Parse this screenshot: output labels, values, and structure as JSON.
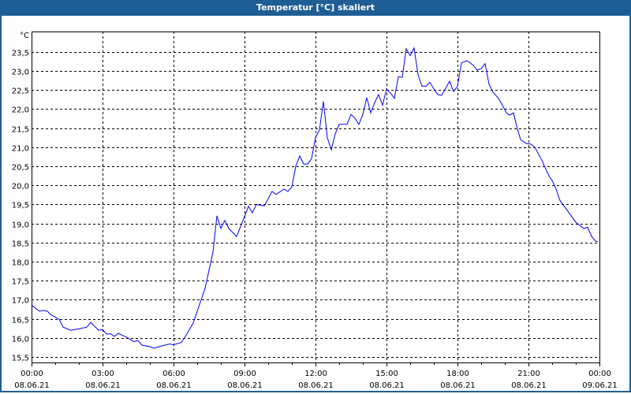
{
  "window": {
    "title": "Temperatur [°C] skaliert"
  },
  "chart_data": {
    "type": "line",
    "title": "Temperatur [°C] skaliert",
    "ylabel": "°C",
    "xlabel": "",
    "xlim_hours": [
      0,
      24
    ],
    "ylim": [
      15.35,
      23.8
    ],
    "grid": true,
    "line_color": "#0000ff",
    "yticks": [
      "15,5",
      "16,0",
      "16,5",
      "17,0",
      "17,5",
      "18,0",
      "18,5",
      "19,0",
      "19,5",
      "20,0",
      "20,5",
      "21,0",
      "21,5",
      "22,0",
      "22,5",
      "23,0",
      "23,5"
    ],
    "ytick_values": [
      15.5,
      16,
      16.5,
      17,
      17.5,
      18,
      18.5,
      19,
      19.5,
      20,
      20.5,
      21,
      21.5,
      22,
      22.5,
      23,
      23.5
    ],
    "xticks": [
      {
        "hour": 0,
        "time": "00:00",
        "date": "08.06.21"
      },
      {
        "hour": 3,
        "time": "03:00",
        "date": "08.06.21"
      },
      {
        "hour": 6,
        "time": "06:00",
        "date": "08.06.21"
      },
      {
        "hour": 9,
        "time": "09:00",
        "date": "08.06.21"
      },
      {
        "hour": 12,
        "time": "12:00",
        "date": "08.06.21"
      },
      {
        "hour": 15,
        "time": "15:00",
        "date": "08.06.21"
      },
      {
        "hour": 18,
        "time": "18:00",
        "date": "08.06.21"
      },
      {
        "hour": 21,
        "time": "21:00",
        "date": "08.06.21"
      },
      {
        "hour": 24,
        "time": "00:00",
        "date": "09.06.21"
      }
    ],
    "series": [
      {
        "name": "Temperatur",
        "points": [
          [
            0,
            16.86
          ],
          [
            0.333,
            16.7
          ],
          [
            0.5,
            16.72
          ],
          [
            0.667,
            16.7
          ],
          [
            0.833,
            16.6
          ],
          [
            1.167,
            16.49
          ],
          [
            1.333,
            16.28
          ],
          [
            1.667,
            16.2
          ],
          [
            2,
            16.24
          ],
          [
            2.333,
            16.28
          ],
          [
            2.5,
            16.41
          ],
          [
            2.833,
            16.2
          ],
          [
            3,
            16.22
          ],
          [
            3.167,
            16.1
          ],
          [
            3.333,
            16.11
          ],
          [
            3.5,
            16.04
          ],
          [
            3.667,
            16.12
          ],
          [
            4,
            16.02
          ],
          [
            4.333,
            15.9
          ],
          [
            4.5,
            15.93
          ],
          [
            4.667,
            15.81
          ],
          [
            5,
            15.77
          ],
          [
            5.167,
            15.73
          ],
          [
            5.5,
            15.79
          ],
          [
            5.833,
            15.84
          ],
          [
            6,
            15.82
          ],
          [
            6.333,
            15.88
          ],
          [
            6.5,
            16.04
          ],
          [
            6.833,
            16.39
          ],
          [
            7.167,
            17.0
          ],
          [
            7.333,
            17.3
          ],
          [
            7.667,
            18.25
          ],
          [
            7.833,
            19.2
          ],
          [
            8,
            18.87
          ],
          [
            8.167,
            19.08
          ],
          [
            8.333,
            18.87
          ],
          [
            8.667,
            18.66
          ],
          [
            9,
            19.18
          ],
          [
            9.167,
            19.45
          ],
          [
            9.333,
            19.28
          ],
          [
            9.5,
            19.5
          ],
          [
            9.833,
            19.46
          ],
          [
            10.167,
            19.84
          ],
          [
            10.333,
            19.76
          ],
          [
            10.667,
            19.9
          ],
          [
            10.833,
            19.84
          ],
          [
            11,
            19.96
          ],
          [
            11.167,
            20.5
          ],
          [
            11.333,
            20.77
          ],
          [
            11.5,
            20.56
          ],
          [
            11.667,
            20.56
          ],
          [
            11.833,
            20.7
          ],
          [
            12,
            21.25
          ],
          [
            12.167,
            21.45
          ],
          [
            12.333,
            22.2
          ],
          [
            12.5,
            21.25
          ],
          [
            12.667,
            20.93
          ],
          [
            12.833,
            21.35
          ],
          [
            13,
            21.6
          ],
          [
            13.333,
            21.6
          ],
          [
            13.5,
            21.86
          ],
          [
            13.667,
            21.76
          ],
          [
            13.833,
            21.6
          ],
          [
            14,
            21.86
          ],
          [
            14.167,
            22.3
          ],
          [
            14.333,
            21.9
          ],
          [
            14.5,
            22.17
          ],
          [
            14.667,
            22.38
          ],
          [
            14.833,
            22.1
          ],
          [
            15,
            22.52
          ],
          [
            15.167,
            22.42
          ],
          [
            15.333,
            22.28
          ],
          [
            15.5,
            22.85
          ],
          [
            15.667,
            22.83
          ],
          [
            15.833,
            23.58
          ],
          [
            16,
            23.4
          ],
          [
            16.167,
            23.6
          ],
          [
            16.333,
            22.9
          ],
          [
            16.5,
            22.6
          ],
          [
            16.667,
            22.6
          ],
          [
            16.833,
            22.7
          ],
          [
            17,
            22.53
          ],
          [
            17.167,
            22.38
          ],
          [
            17.333,
            22.36
          ],
          [
            17.667,
            22.73
          ],
          [
            17.833,
            22.46
          ],
          [
            18,
            22.59
          ],
          [
            18.167,
            23.21
          ],
          [
            18.4,
            23.27
          ],
          [
            18.667,
            23.15
          ],
          [
            18.833,
            23.02
          ],
          [
            19,
            23.06
          ],
          [
            19.167,
            23.19
          ],
          [
            19.333,
            22.65
          ],
          [
            19.5,
            22.44
          ],
          [
            19.733,
            22.28
          ],
          [
            19.9,
            22.1
          ],
          [
            20.067,
            21.9
          ],
          [
            20.2,
            21.84
          ],
          [
            20.367,
            21.9
          ],
          [
            20.5,
            21.55
          ],
          [
            20.667,
            21.2
          ],
          [
            20.9,
            21.1
          ],
          [
            21.1,
            21.08
          ],
          [
            21.267,
            21.0
          ],
          [
            21.567,
            20.66
          ],
          [
            21.733,
            20.42
          ],
          [
            21.9,
            20.21
          ],
          [
            22,
            20.13
          ],
          [
            22.167,
            19.9
          ],
          [
            22.333,
            19.6
          ],
          [
            22.667,
            19.32
          ],
          [
            23,
            19.03
          ],
          [
            23.333,
            18.87
          ],
          [
            23.5,
            18.9
          ],
          [
            23.667,
            18.66
          ],
          [
            23.833,
            18.54
          ],
          [
            23.933,
            18.52
          ]
        ]
      }
    ]
  }
}
